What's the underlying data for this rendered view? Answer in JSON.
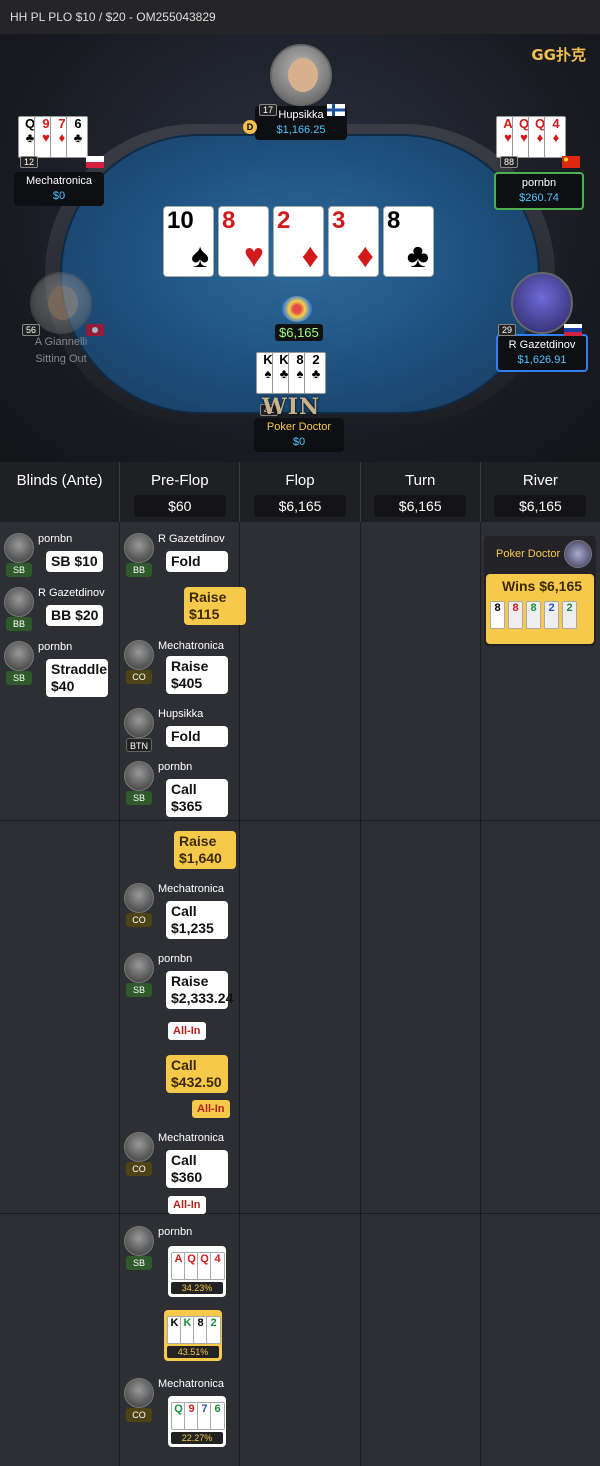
{
  "title": "HH PL PLO $10 / $20   - OM255043829",
  "logo": "GG扑克",
  "seats": {
    "top": {
      "name": "Hupsikka",
      "stack": "$1,166.25",
      "level": "17",
      "dealer": "D"
    },
    "left_top": {
      "name": "Mechatronica",
      "stack": "$0",
      "level": "12",
      "cards": [
        {
          "r": "Q",
          "s": "♣",
          "c": "black"
        },
        {
          "r": "9",
          "s": "♥",
          "c": "red"
        },
        {
          "r": "7",
          "s": "♦",
          "c": "red"
        },
        {
          "r": "6",
          "s": "♣",
          "c": "black"
        }
      ]
    },
    "right_top": {
      "name": "pornbn",
      "stack": "$260.74",
      "level": "88",
      "cards": [
        {
          "r": "A",
          "s": "♥",
          "c": "red"
        },
        {
          "r": "Q",
          "s": "♥",
          "c": "red"
        },
        {
          "r": "Q",
          "s": "♦",
          "c": "red"
        },
        {
          "r": "4",
          "s": "♦",
          "c": "red"
        }
      ]
    },
    "left_mid": {
      "name": "A Giannelli",
      "stack": "Sitting Out",
      "level": "56"
    },
    "right_mid": {
      "name": "R Gazetdinov",
      "stack": "$1,626.91",
      "level": "29"
    },
    "bottom": {
      "name": "Poker Doctor",
      "stack": "$0",
      "level": "41",
      "cards": [
        {
          "r": "K",
          "s": "♠",
          "c": "black"
        },
        {
          "r": "K",
          "s": "♣",
          "c": "black"
        },
        {
          "r": "8",
          "s": "♠",
          "c": "black"
        },
        {
          "r": "2",
          "s": "♣",
          "c": "black"
        }
      ],
      "win_label": "WIN"
    }
  },
  "board": [
    {
      "r": "10",
      "s": "♠",
      "c": "black"
    },
    {
      "r": "8",
      "s": "♥",
      "c": "red"
    },
    {
      "r": "2",
      "s": "♦",
      "c": "red"
    },
    {
      "r": "3",
      "s": "♦",
      "c": "red"
    },
    {
      "r": "8",
      "s": "♣",
      "c": "black"
    }
  ],
  "pot": "$6,165",
  "streets": [
    {
      "title": "Blinds (Ante)",
      "amount": ""
    },
    {
      "title": "Pre-Flop",
      "amount": "$60"
    },
    {
      "title": "Flop",
      "amount": "$6,165"
    },
    {
      "title": "Turn",
      "amount": "$6,165"
    },
    {
      "title": "River",
      "amount": "$6,165"
    }
  ],
  "blinds": [
    {
      "name": "pornbn",
      "pos": "SB",
      "action": "SB $10"
    },
    {
      "name": "R Gazetdinov",
      "pos": "BB",
      "action": "BB $20"
    },
    {
      "name": "pornbn",
      "pos": "SB",
      "action": "Straddle $40"
    }
  ],
  "preflop": [
    {
      "name": "R Gazetdinov",
      "pos": "BB",
      "action": "Fold"
    },
    {
      "name": "",
      "pos": "",
      "action": "Raise $115",
      "hero": true
    },
    {
      "name": "Mechatronica",
      "pos": "CO",
      "action": "Raise $405"
    },
    {
      "name": "Hupsikka",
      "pos": "BTN",
      "action": "Fold"
    },
    {
      "name": "pornbn",
      "pos": "SB",
      "action": "Call $365"
    },
    {
      "name": "",
      "pos": "",
      "action": "Raise $1,640",
      "hero": true
    },
    {
      "name": "Mechatronica",
      "pos": "CO",
      "action": "Call $1,235"
    },
    {
      "name": "pornbn",
      "pos": "SB",
      "action": "Raise $2,333.24",
      "allin": "All-In"
    },
    {
      "name": "",
      "pos": "",
      "action": "Call $432.50",
      "hero": true,
      "allin": "All-In"
    },
    {
      "name": "Mechatronica",
      "pos": "CO",
      "action": "Call $360",
      "allin": "All-In"
    }
  ],
  "showdown": [
    {
      "name": "pornbn",
      "pos": "SB",
      "equity": "34.23%",
      "cards": [
        {
          "r": "A",
          "c": "red"
        },
        {
          "r": "Q",
          "c": "red"
        },
        {
          "r": "Q",
          "c": "red"
        },
        {
          "r": "4",
          "c": "red"
        }
      ]
    },
    {
      "name": "",
      "pos": "",
      "equity": "43.51%",
      "hero": true,
      "cards": [
        {
          "r": "K",
          "c": "black"
        },
        {
          "r": "K",
          "c": "green"
        },
        {
          "r": "8",
          "c": "black"
        },
        {
          "r": "2",
          "c": "green"
        }
      ]
    },
    {
      "name": "Mechatronica",
      "pos": "CO",
      "equity": "22.27%",
      "cards": [
        {
          "r": "Q",
          "c": "green"
        },
        {
          "r": "9",
          "c": "red"
        },
        {
          "r": "7",
          "c": "blue"
        },
        {
          "r": "6",
          "c": "green"
        }
      ]
    }
  ],
  "river_winner": {
    "name": "Poker Doctor",
    "wins": "Wins $6,165",
    "cards": [
      {
        "r": "8",
        "c": "black"
      },
      {
        "r": "8",
        "c": "red"
      },
      {
        "r": "8",
        "c": "green"
      },
      {
        "r": "2",
        "c": "blue"
      },
      {
        "r": "2",
        "c": "green"
      }
    ]
  }
}
